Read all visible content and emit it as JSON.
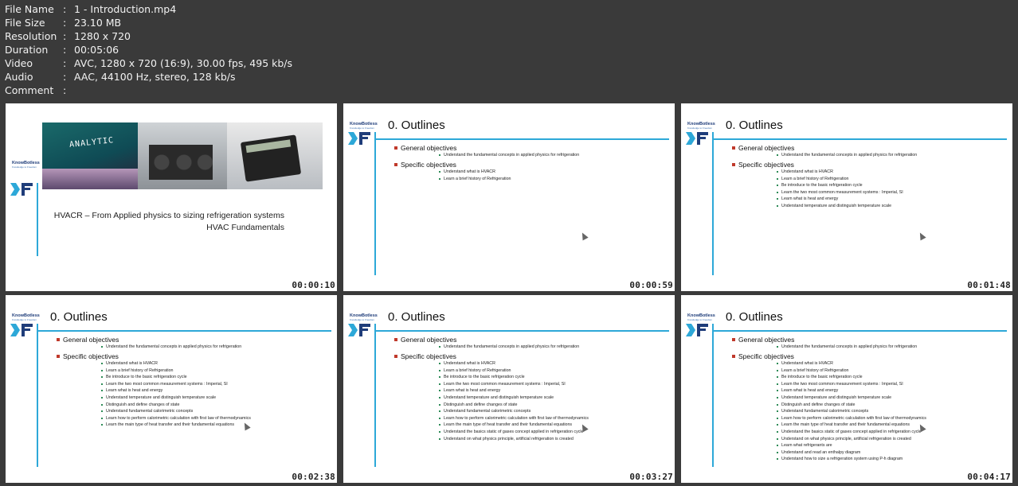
{
  "meta": [
    {
      "key": "File Name",
      "value": "1 - Introduction.mp4"
    },
    {
      "key": "File Size",
      "value": "23.10 MB"
    },
    {
      "key": "Resolution",
      "value": "1280 x 720"
    },
    {
      "key": "Duration",
      "value": "00:05:06"
    },
    {
      "key": "Video",
      "value": "AVC, 1280 x 720 (16:9), 30.00 fps, 495 kb/s"
    },
    {
      "key": "Audio",
      "value": "AAC, 44100 Hz, stereo, 128 kb/s"
    },
    {
      "key": "Comment",
      "value": ""
    }
  ],
  "meta_separator": ":",
  "brand": {
    "name": "KnowBotless",
    "tag": "Knowledge to Freedom"
  },
  "intro": {
    "banner_text": "ANALYTIC",
    "line1": "HVACR – From Applied physics to sizing refrigeration systems",
    "line2": "HVAC Fundamentals",
    "timestamp": "00:00:10"
  },
  "outline_title": "0. Outlines",
  "general_heading": "General objectives",
  "general_item": "Understand the fundamental concepts in applied physics for refrigeration",
  "specific_heading": "Specific objectives",
  "specific_items": [
    "Understand what is HVACR",
    "Learn a brief history of Refrigeration",
    "Be introduce to the basic refrigeration cycle",
    "Learn the two most common measurement systems : Imperial, SI",
    "Learn what is heat and energy",
    "Understand temperature and distinguish temperature scale",
    "Distinguish and define changes of state",
    "Understand fundamental calorimetric concepts",
    "Learn how to perform calorimetric calculation with first law of thermodynamics",
    "Learn the main type of heat transfer and their fundamental equations",
    "Understand the basics static of gases concept applied in refrigeration cycle",
    "Understand on what physics principle, artificial refrigeration is created",
    "Learn what refrigerants are",
    "Understand and read an enthalpy diagram",
    "Understand how to size a refrigeration system using P-h diagram"
  ],
  "thumbnails": [
    {
      "timestamp": "00:00:59",
      "count": 2
    },
    {
      "timestamp": "00:01:48",
      "count": 6
    },
    {
      "timestamp": "00:02:38",
      "count": 10
    },
    {
      "timestamp": "00:03:27",
      "count": 12
    },
    {
      "timestamp": "00:04:17",
      "count": 15
    }
  ]
}
